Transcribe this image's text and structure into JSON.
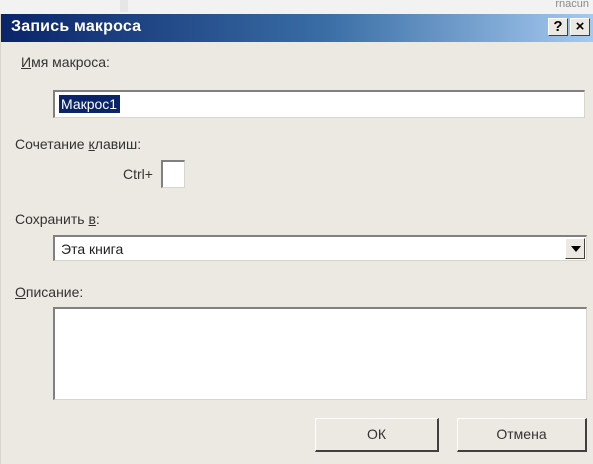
{
  "background_strip": {
    "text": "rnacun"
  },
  "dialog": {
    "title": "Запись макроса",
    "help_label": "?",
    "close_label": "×",
    "macro_name": {
      "label_underlined": "И",
      "label_rest": "мя макроса:",
      "value": "Макрос1"
    },
    "shortcut": {
      "label_before": "Сочетание ",
      "label_underlined": "к",
      "label_after": "лавиш:",
      "prefix": "Ctrl+",
      "value": ""
    },
    "store_in": {
      "label_before": "Сохранить ",
      "label_underlined": "в",
      "label_after": ":",
      "selected": "Эта книга"
    },
    "description": {
      "label_underlined": "О",
      "label_rest": "писание:",
      "value": ""
    },
    "ok_label": "ОК",
    "cancel_label": "Отмена"
  }
}
